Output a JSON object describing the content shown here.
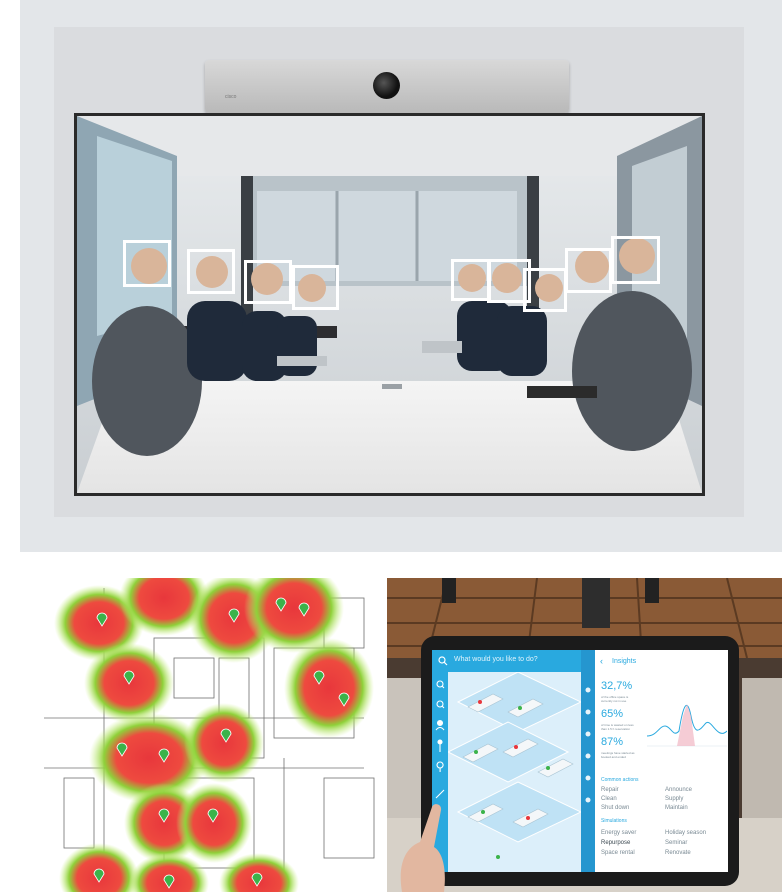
{
  "camera": {
    "brand": "cisco"
  },
  "tablet": {
    "search_placeholder": "What would you like to do?",
    "insights_title": "Insights",
    "stats": [
      {
        "value": "32,7%",
        "desc": "of the office space is currently not in use"
      },
      {
        "value": "65%",
        "desc": "of time is wasted on less than 1.5 h reservation"
      },
      {
        "value": "87%",
        "desc": "meetings have started as booked and ended"
      }
    ],
    "common_actions_heading": "Common actions",
    "simulations_heading": "Simulations",
    "actions_left": [
      "Repair",
      "Clean",
      "Shut down"
    ],
    "actions_right": [
      "Announce",
      "Supply",
      "Maintain"
    ],
    "sim_left": [
      "Energy saver",
      "Repurpose",
      "Space rental"
    ],
    "sim_right": [
      "Holiday season",
      "Seminar",
      "Renovate"
    ]
  },
  "colors": {
    "accent": "#29a9df",
    "heat_hot": "#e8373c",
    "heat_warm": "#7cd13a"
  }
}
